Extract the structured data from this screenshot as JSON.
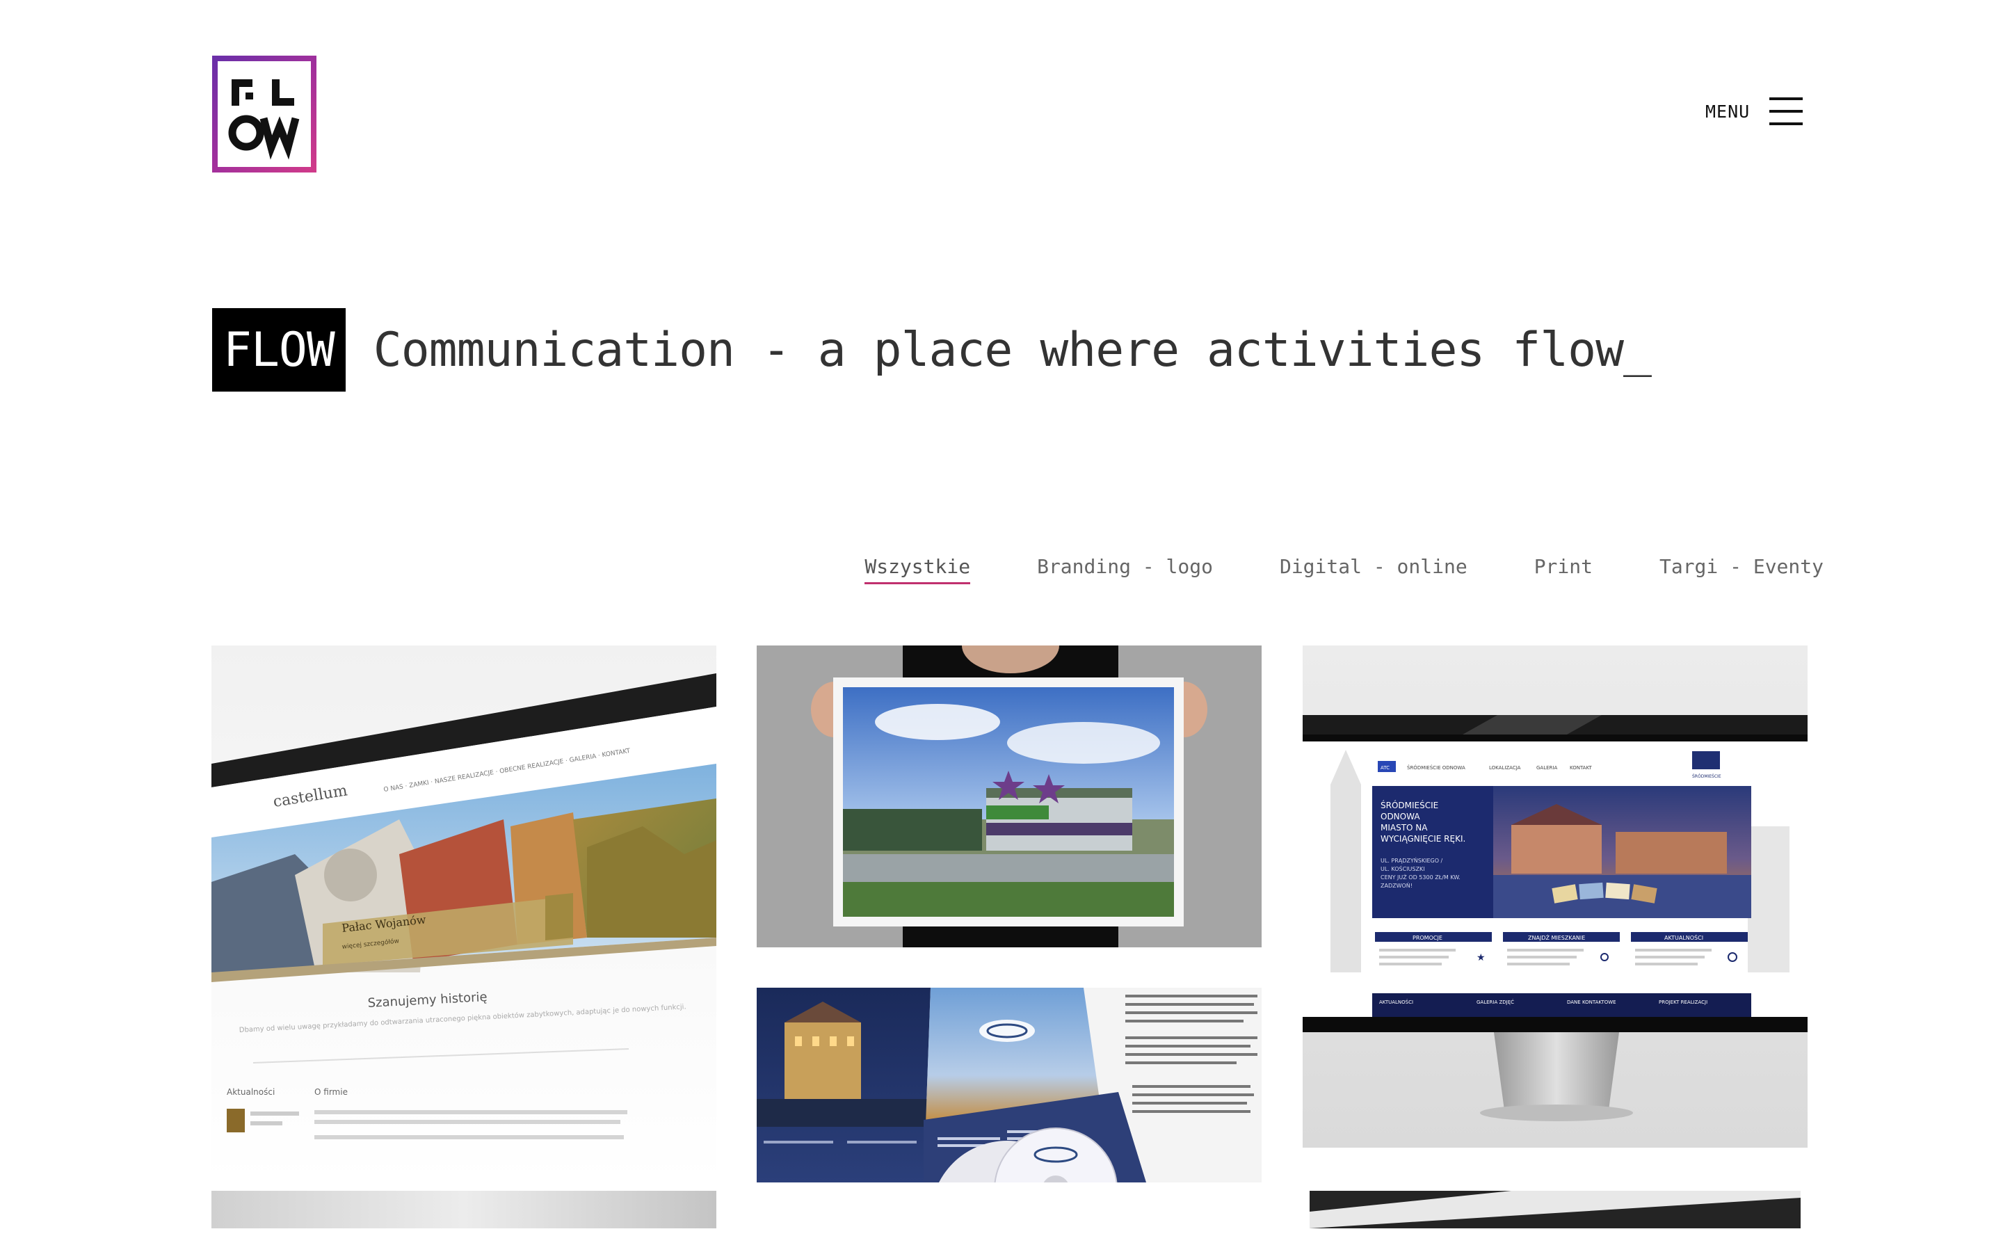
{
  "header": {
    "logo_alt": "FLOW",
    "menu_label": "MENU"
  },
  "hero": {
    "badge": "FLOW",
    "tagline": "Communication - a place where activities flow_"
  },
  "filters": [
    {
      "label": "Wszystkie",
      "active": true
    },
    {
      "label": "Branding - logo",
      "active": false
    },
    {
      "label": "Digital - online",
      "active": false
    },
    {
      "label": "Print",
      "active": false
    },
    {
      "label": "Targi - Eventy",
      "active": false
    }
  ],
  "portfolio": {
    "castellum": {
      "nav": "O NAS  ·  ZAMKI  ·  NASZE REALIZACJE  ·  OBECNE REALIZACJE  ·  GALERIA  ·  KONTAKT",
      "logo_text": "castellum",
      "banner_title": "Pałac Wojanów",
      "banner_sub": "więcej szczegółów",
      "heading": "Szanujemy historię",
      "intro": "Dbamy od wielu uwagę przykładamy do odtwarzania utraconego piękna obiektów zabytkowych, adaptując je do nowych funkcji.",
      "news_label": "Aktualności",
      "about_label": "O firmie"
    },
    "srodmiescie": {
      "nav": [
        "ATC",
        "ŚRÓDMIEŚCIE ODNOWA",
        "LOKALIZACJA",
        "GALERIA",
        "KONTAKT"
      ],
      "headline": [
        "ŚRÓDMIEŚCIE",
        "ODNOWA",
        "MIASTO NA",
        "WYCIĄGNIĘCIE RĘKI."
      ],
      "address": [
        "UL. PRĄDZYŃSKIEGO /",
        "UL. KOŚCIUSZKI",
        "CENY JUŻ OD 5300 ZŁ/M KW.",
        "ZADZWOŃ!"
      ],
      "boxes": [
        "PROMOCJE",
        "ZNAJDŹ MIESZKANIE",
        "AKTUALNOŚCI"
      ],
      "footer": [
        "AKTUALNOŚCI",
        "GALERIA ZDJĘĆ",
        "DANE KONTAKTOWE",
        "PROJEKT REALIZACJI"
      ],
      "brand": "ŚRÓDMIEŚCIE"
    }
  },
  "colors": {
    "logo_gradient_start": "#6b2fa8",
    "logo_gradient_end": "#cf3a8a",
    "filter_underline": "#c0306e"
  }
}
